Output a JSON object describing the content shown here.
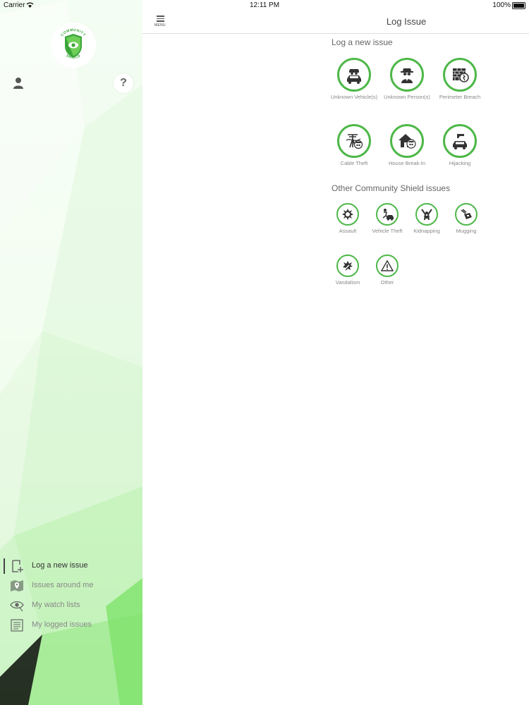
{
  "status_bar": {
    "carrier": "Carrier",
    "time": "12:11 PM",
    "battery": "100%"
  },
  "sidebar": {
    "logo": {
      "top_text": "COMMUNITY",
      "bottom_text": "SHIELD"
    },
    "help_label": "?",
    "menu": [
      {
        "label": "Log a new issue",
        "icon": "add-document-icon",
        "active": true
      },
      {
        "label": "Issues around me",
        "icon": "map-pin-icon",
        "active": false
      },
      {
        "label": "My watch lists",
        "icon": "eye-icon",
        "active": false
      },
      {
        "label": "My logged issues",
        "icon": "list-icon",
        "active": false
      }
    ]
  },
  "navbar": {
    "menu_label": "MENU",
    "title": "Log Issue"
  },
  "main": {
    "new_issue_title": "Log a new issue",
    "new_issues": [
      {
        "label": "Unknown Vehicle(s)",
        "icon": "car-spy-icon"
      },
      {
        "label": "Unknown Person(s)",
        "icon": "spy-person-icon"
      },
      {
        "label": "Perimeter Breach",
        "icon": "wall-breach-icon"
      },
      {
        "label": "Cable Theft",
        "icon": "cable-theft-icon"
      },
      {
        "label": "House Break-In",
        "icon": "house-break-in-icon"
      },
      {
        "label": "Hijacking",
        "icon": "hijacking-icon"
      }
    ],
    "other_title": "Other Community Shield issues",
    "other_issues": [
      {
        "label": "Assault",
        "icon": "assault-icon"
      },
      {
        "label": "Vehicle Theft",
        "icon": "vehicle-theft-icon"
      },
      {
        "label": "Kidnapping",
        "icon": "kidnapping-icon"
      },
      {
        "label": "Mugging",
        "icon": "mugging-icon"
      },
      {
        "label": "Vandalism",
        "icon": "vandalism-icon"
      },
      {
        "label": "Other",
        "icon": "warning-icon"
      }
    ]
  },
  "colors": {
    "accent": "#4db848",
    "sidebar_gradient_end": "#b9f0ad",
    "icon_dark": "#333333"
  }
}
